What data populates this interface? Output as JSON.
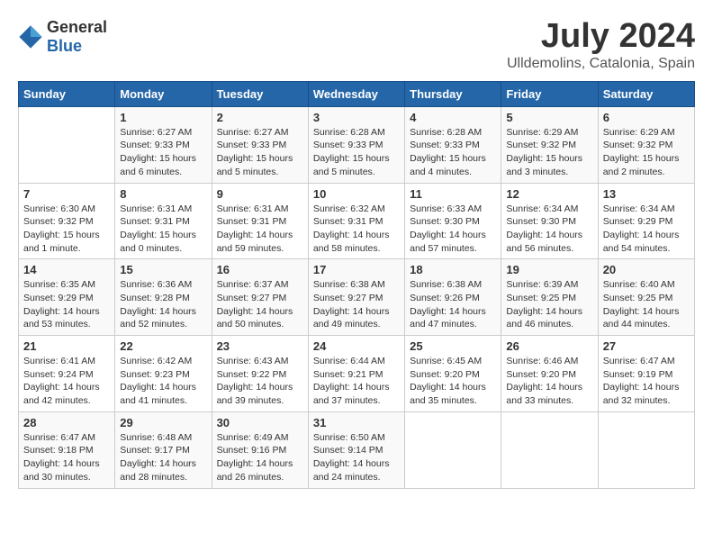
{
  "logo": {
    "general": "General",
    "blue": "Blue"
  },
  "title": "July 2024",
  "subtitle": "Ulldemolins, Catalonia, Spain",
  "days_header": [
    "Sunday",
    "Monday",
    "Tuesday",
    "Wednesday",
    "Thursday",
    "Friday",
    "Saturday"
  ],
  "weeks": [
    [
      {
        "day": "",
        "info": ""
      },
      {
        "day": "1",
        "info": "Sunrise: 6:27 AM\nSunset: 9:33 PM\nDaylight: 15 hours\nand 6 minutes."
      },
      {
        "day": "2",
        "info": "Sunrise: 6:27 AM\nSunset: 9:33 PM\nDaylight: 15 hours\nand 5 minutes."
      },
      {
        "day": "3",
        "info": "Sunrise: 6:28 AM\nSunset: 9:33 PM\nDaylight: 15 hours\nand 5 minutes."
      },
      {
        "day": "4",
        "info": "Sunrise: 6:28 AM\nSunset: 9:33 PM\nDaylight: 15 hours\nand 4 minutes."
      },
      {
        "day": "5",
        "info": "Sunrise: 6:29 AM\nSunset: 9:32 PM\nDaylight: 15 hours\nand 3 minutes."
      },
      {
        "day": "6",
        "info": "Sunrise: 6:29 AM\nSunset: 9:32 PM\nDaylight: 15 hours\nand 2 minutes."
      }
    ],
    [
      {
        "day": "7",
        "info": "Sunrise: 6:30 AM\nSunset: 9:32 PM\nDaylight: 15 hours\nand 1 minute."
      },
      {
        "day": "8",
        "info": "Sunrise: 6:31 AM\nSunset: 9:31 PM\nDaylight: 15 hours\nand 0 minutes."
      },
      {
        "day": "9",
        "info": "Sunrise: 6:31 AM\nSunset: 9:31 PM\nDaylight: 14 hours\nand 59 minutes."
      },
      {
        "day": "10",
        "info": "Sunrise: 6:32 AM\nSunset: 9:31 PM\nDaylight: 14 hours\nand 58 minutes."
      },
      {
        "day": "11",
        "info": "Sunrise: 6:33 AM\nSunset: 9:30 PM\nDaylight: 14 hours\nand 57 minutes."
      },
      {
        "day": "12",
        "info": "Sunrise: 6:34 AM\nSunset: 9:30 PM\nDaylight: 14 hours\nand 56 minutes."
      },
      {
        "day": "13",
        "info": "Sunrise: 6:34 AM\nSunset: 9:29 PM\nDaylight: 14 hours\nand 54 minutes."
      }
    ],
    [
      {
        "day": "14",
        "info": "Sunrise: 6:35 AM\nSunset: 9:29 PM\nDaylight: 14 hours\nand 53 minutes."
      },
      {
        "day": "15",
        "info": "Sunrise: 6:36 AM\nSunset: 9:28 PM\nDaylight: 14 hours\nand 52 minutes."
      },
      {
        "day": "16",
        "info": "Sunrise: 6:37 AM\nSunset: 9:27 PM\nDaylight: 14 hours\nand 50 minutes."
      },
      {
        "day": "17",
        "info": "Sunrise: 6:38 AM\nSunset: 9:27 PM\nDaylight: 14 hours\nand 49 minutes."
      },
      {
        "day": "18",
        "info": "Sunrise: 6:38 AM\nSunset: 9:26 PM\nDaylight: 14 hours\nand 47 minutes."
      },
      {
        "day": "19",
        "info": "Sunrise: 6:39 AM\nSunset: 9:25 PM\nDaylight: 14 hours\nand 46 minutes."
      },
      {
        "day": "20",
        "info": "Sunrise: 6:40 AM\nSunset: 9:25 PM\nDaylight: 14 hours\nand 44 minutes."
      }
    ],
    [
      {
        "day": "21",
        "info": "Sunrise: 6:41 AM\nSunset: 9:24 PM\nDaylight: 14 hours\nand 42 minutes."
      },
      {
        "day": "22",
        "info": "Sunrise: 6:42 AM\nSunset: 9:23 PM\nDaylight: 14 hours\nand 41 minutes."
      },
      {
        "day": "23",
        "info": "Sunrise: 6:43 AM\nSunset: 9:22 PM\nDaylight: 14 hours\nand 39 minutes."
      },
      {
        "day": "24",
        "info": "Sunrise: 6:44 AM\nSunset: 9:21 PM\nDaylight: 14 hours\nand 37 minutes."
      },
      {
        "day": "25",
        "info": "Sunrise: 6:45 AM\nSunset: 9:20 PM\nDaylight: 14 hours\nand 35 minutes."
      },
      {
        "day": "26",
        "info": "Sunrise: 6:46 AM\nSunset: 9:20 PM\nDaylight: 14 hours\nand 33 minutes."
      },
      {
        "day": "27",
        "info": "Sunrise: 6:47 AM\nSunset: 9:19 PM\nDaylight: 14 hours\nand 32 minutes."
      }
    ],
    [
      {
        "day": "28",
        "info": "Sunrise: 6:47 AM\nSunset: 9:18 PM\nDaylight: 14 hours\nand 30 minutes."
      },
      {
        "day": "29",
        "info": "Sunrise: 6:48 AM\nSunset: 9:17 PM\nDaylight: 14 hours\nand 28 minutes."
      },
      {
        "day": "30",
        "info": "Sunrise: 6:49 AM\nSunset: 9:16 PM\nDaylight: 14 hours\nand 26 minutes."
      },
      {
        "day": "31",
        "info": "Sunrise: 6:50 AM\nSunset: 9:14 PM\nDaylight: 14 hours\nand 24 minutes."
      },
      {
        "day": "",
        "info": ""
      },
      {
        "day": "",
        "info": ""
      },
      {
        "day": "",
        "info": ""
      }
    ]
  ]
}
